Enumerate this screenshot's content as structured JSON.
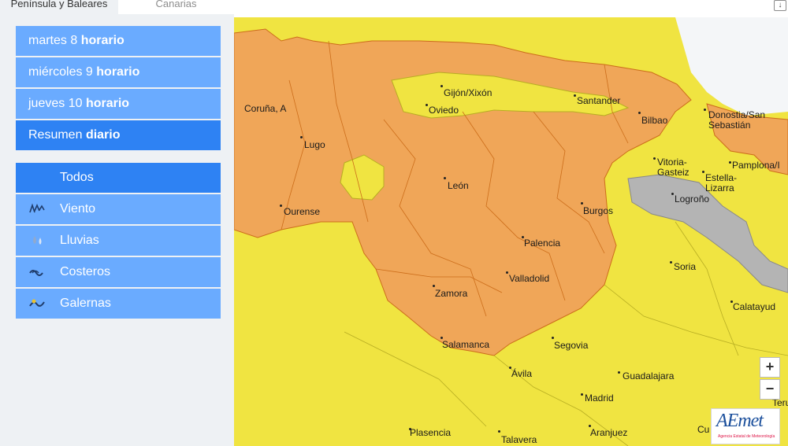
{
  "tabs": {
    "active": "Península y Baleares",
    "inactive": "Canarias"
  },
  "days": [
    {
      "day": "martes 8",
      "mode": "horario"
    },
    {
      "day": "miércoles 9",
      "mode": "horario"
    },
    {
      "day": "jueves 10",
      "mode": "horario"
    },
    {
      "day": "Resumen",
      "mode": "diario"
    }
  ],
  "filters": [
    {
      "label": "Todos",
      "icon": "all-icon"
    },
    {
      "label": "Viento",
      "icon": "wind-icon"
    },
    {
      "label": "Lluvias",
      "icon": "rain-icon"
    },
    {
      "label": "Costeros",
      "icon": "coastal-waves-icon"
    },
    {
      "label": "Galernas",
      "icon": "gale-icon"
    }
  ],
  "map": {
    "colors": {
      "orange": "#f0a658",
      "yellow": "#f0e441",
      "gray": "#b4b4b4",
      "border": "#cc6d1a",
      "yellow_border": "#b7ad22"
    },
    "cities": [
      "Coruña, A",
      "Lugo",
      "Ourense",
      "Gijón/Xixón",
      "Oviedo",
      "Santander",
      "Bilbao",
      "Donostia/San Sebastián",
      "Vitoria-Gasteiz",
      "Pamplona/I",
      "Estella-Lizarra",
      "Logroño",
      "León",
      "Burgos",
      "Palencia",
      "Valladolid",
      "Zamora",
      "Soria",
      "Calatayud",
      "Salamanca",
      "Segovia",
      "Ávila",
      "Guadalajara",
      "Madrid",
      "Plasencia",
      "Talavera",
      "Aranjuez",
      "Cu",
      "Teru"
    ],
    "zoom_in": "+",
    "zoom_out": "−"
  },
  "logo": {
    "wordmark": "AEmet",
    "subtitle": "Agencia Estatal de Meteorología"
  }
}
